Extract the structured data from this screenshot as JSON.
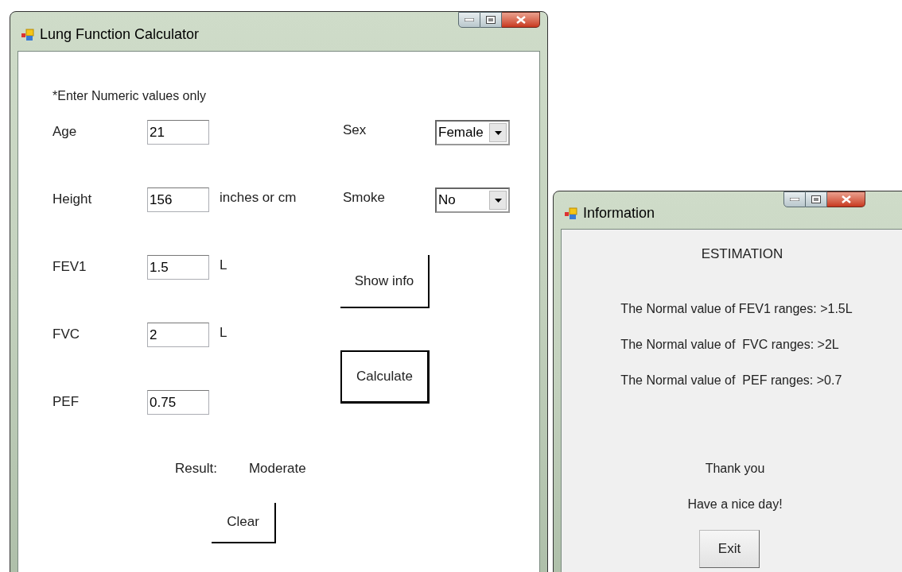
{
  "main_window": {
    "title": "Lung Function Calculator",
    "note": "*Enter Numeric values only",
    "fields": [
      {
        "label": "Age",
        "value": "21"
      },
      {
        "label": "Height",
        "value": "156",
        "unit": "inches or cm"
      },
      {
        "label": "FEV1",
        "value": "1.5",
        "unit": "L"
      },
      {
        "label": "FVC",
        "value": "2",
        "unit": "L"
      },
      {
        "label": "PEF",
        "value": "0.75"
      }
    ],
    "dropdowns": [
      {
        "label": "Sex",
        "value": "Female"
      },
      {
        "label": "Smoke",
        "value": "No"
      }
    ],
    "buttons": [
      {
        "label": "Show info",
        "default": false
      },
      {
        "label": "Calculate",
        "default": true
      }
    ],
    "result": {
      "label": "Result:",
      "value": "Moderate"
    },
    "clear_button": "Clear"
  },
  "info_window": {
    "title": "Information",
    "heading": "ESTIMATION",
    "lines": [
      "The Normal value of FEV1 ranges: >1.5L",
      "The Normal value of  FVC ranges: >2L",
      "The Normal value of  PEF ranges: >0.7"
    ],
    "closing": [
      "Thank you",
      "Have a nice day!"
    ],
    "exit_button": "Exit"
  }
}
